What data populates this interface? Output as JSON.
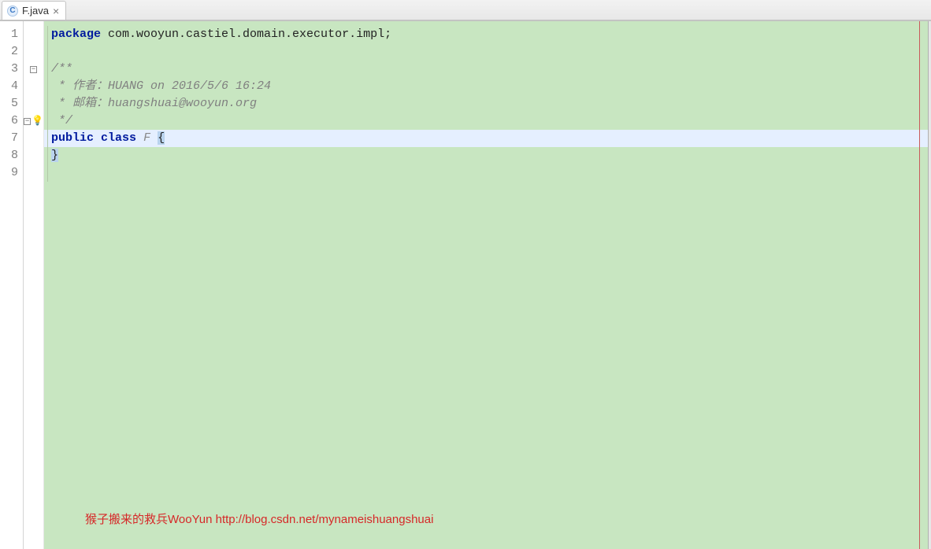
{
  "tab": {
    "icon_letter": "C",
    "label": "F.java",
    "close": "×"
  },
  "line_numbers": [
    "1",
    "2",
    "3",
    "4",
    "5",
    "6",
    "7",
    "8",
    "9"
  ],
  "marks": {
    "fold_minus": "−",
    "bulb": "💡"
  },
  "code": {
    "l1_kw": "package",
    "l1_rest": " com.wooyun.castiel.domain.executor.impl;",
    "l3": "/**",
    "l4": " * 作者：HUANG on 2016/5/6 16:24",
    "l5": " * 邮箱：huangshuai@wooyun.org",
    "l6": " */",
    "l7_kw1": "public",
    "l7_kw2": "class",
    "l7_cls": "F",
    "l7_brace": "{",
    "l8_brace": "}"
  },
  "watermark": "猴子搬来的救兵WooYun http://blog.csdn.net/mynameishuangshuai"
}
